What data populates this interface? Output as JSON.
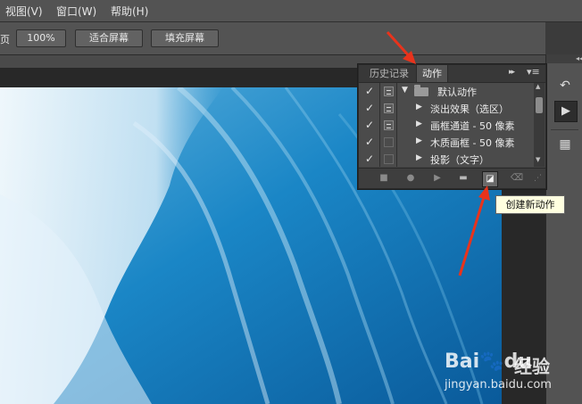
{
  "menu": {
    "items": [
      "视图(V)",
      "窗口(W)",
      "帮助(H)"
    ]
  },
  "options": {
    "fragment": "页",
    "zoom_label": "100%",
    "fit_screen_label": "适合屏幕",
    "fill_screen_label": "填充屏幕"
  },
  "panel": {
    "tabs": [
      "历史记录",
      "动作"
    ],
    "active_tab": "动作",
    "fast_forward": "▸▸",
    "menu_glyph": "▾≡",
    "rows": [
      {
        "check": "✓",
        "dialog": "filled",
        "label": "默认动作",
        "expanded": true,
        "folder": true
      },
      {
        "check": "✓",
        "dialog": "filled",
        "label": "淡出效果（选区）",
        "expanded": false,
        "folder": false
      },
      {
        "check": "✓",
        "dialog": "filled",
        "label": "画框通道 - 50 像素",
        "expanded": false,
        "folder": false
      },
      {
        "check": "✓",
        "dialog": "empty",
        "label": "木质画框 - 50 像素",
        "expanded": false,
        "folder": false
      },
      {
        "check": "✓",
        "dialog": "empty",
        "label": "投影（文字）",
        "expanded": false,
        "folder": false
      }
    ],
    "footer_buttons": [
      "stop-icon",
      "record-icon",
      "play-icon",
      "folder-icon",
      "new-action-icon",
      "trash-icon"
    ],
    "highlighted_button": "new-action-icon"
  },
  "tooltip": {
    "text": "创建新动作"
  },
  "dock": {
    "collapse": "◂◂",
    "icons": [
      "history-icon",
      "actions-play-icon",
      "swatches-icon"
    ]
  },
  "watermark": {
    "brand_a": "Bai",
    "brand_b": "du",
    "brand_cn": "经验",
    "url": "jingyan.baidu.com"
  },
  "colors": {
    "arrow": "#e8331c",
    "ui_dark": "#535353",
    "panel": "#434343",
    "tooltip_bg": "#ffffe0"
  }
}
